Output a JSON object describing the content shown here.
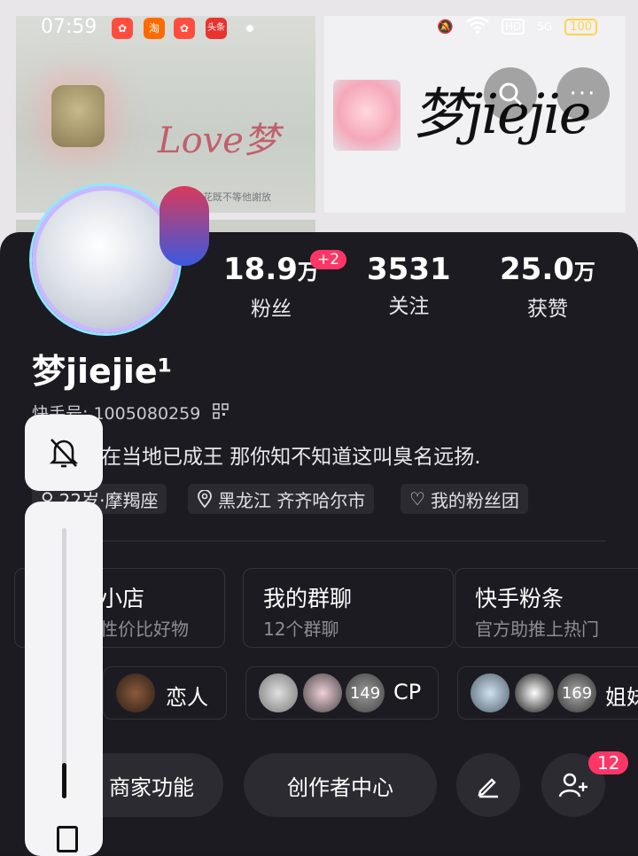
{
  "status_bar": {
    "time": "07:59",
    "apps": [
      {
        "icon": "kuaishou-icon",
        "color": "#ff4d3d"
      },
      {
        "icon": "taobao-icon",
        "label": "淘",
        "color": "#ff6a00"
      },
      {
        "icon": "kuaishou-icon",
        "color": "#ff4d3d"
      },
      {
        "icon": "toutiao-icon",
        "label": "头条",
        "color": "#e8332f"
      }
    ],
    "network": "5G",
    "hd": "HD",
    "battery": "100"
  },
  "banner": {
    "left_photo_text": "Love梦",
    "left_photo_small": "的花既不等他謝放",
    "right_brand_text": "梦jiejie"
  },
  "profile": {
    "stats": [
      {
        "value": "18.9",
        "unit": "万",
        "label": "粉丝"
      },
      {
        "value": "3531",
        "unit": "",
        "label": "关注"
      },
      {
        "value": "25.0",
        "unit": "万",
        "label": "获赞"
      }
    ],
    "fans_badge": "+2",
    "name": "梦jiejie¹",
    "kuaishou_id": "快手号: 1005080259",
    "bio": "在当地已成王 那你知不知道这叫臭名远扬.",
    "tags": [
      {
        "label": "22岁·摩羯座",
        "icon": "gender-icon"
      },
      {
        "label": "黑龙江 齐齐哈尔市",
        "icon": "location-icon"
      },
      {
        "label": "我的粉丝团",
        "icon": "heart-badge-icon"
      }
    ]
  },
  "services": [
    {
      "title": "小店",
      "subtitle": "性价比好物"
    },
    {
      "title": "我的群聊",
      "subtitle": "12个群聊"
    },
    {
      "title": "快手粉条",
      "subtitle": "官方助推上热门"
    }
  ],
  "relations": [
    {
      "label": "恋人"
    },
    {
      "count": "149",
      "label": "CP"
    },
    {
      "count": "169",
      "label": "姐妹"
    }
  ],
  "actions": {
    "merchant": "商家功能",
    "creator": "创作者中心",
    "add_friend_badge": "12"
  }
}
